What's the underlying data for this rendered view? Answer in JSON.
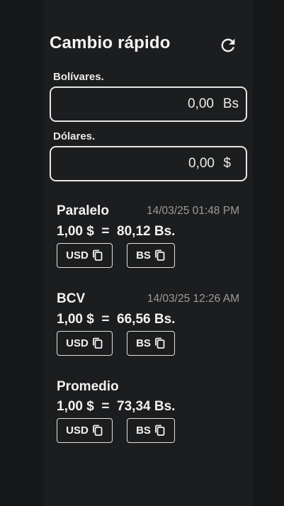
{
  "header": {
    "title": "Cambio rápido",
    "refresh_icon": "refresh-icon"
  },
  "inputs": {
    "bolivares": {
      "label": "Bolívares.",
      "value": "0,00",
      "unit": "Bs"
    },
    "dolares": {
      "label": "Dólares.",
      "value": "0,00",
      "unit": "$"
    }
  },
  "rates": [
    {
      "name": "Paralelo",
      "date": "14/03/25 01:48 PM",
      "equation": "1,00 $  =  80,12 Bs.",
      "usd_label": "USD",
      "bs_label": "BS",
      "copy_icon": "copy-icon"
    },
    {
      "name": "BCV",
      "date": "14/03/25 12:26 AM",
      "equation": "1,00 $  =  66,56 Bs.",
      "usd_label": "USD",
      "bs_label": "BS",
      "copy_icon": "copy-icon"
    },
    {
      "name": "Promedio",
      "date": "",
      "equation": "1,00 $  =  73,34 Bs.",
      "usd_label": "USD",
      "bs_label": "BS",
      "copy_icon": "copy-icon"
    }
  ],
  "colors": {
    "background": "#161718",
    "card": "#1c1d1f",
    "text": "#f2f2f2",
    "muted": "#9b9b9b",
    "border": "#e6e6e6"
  }
}
